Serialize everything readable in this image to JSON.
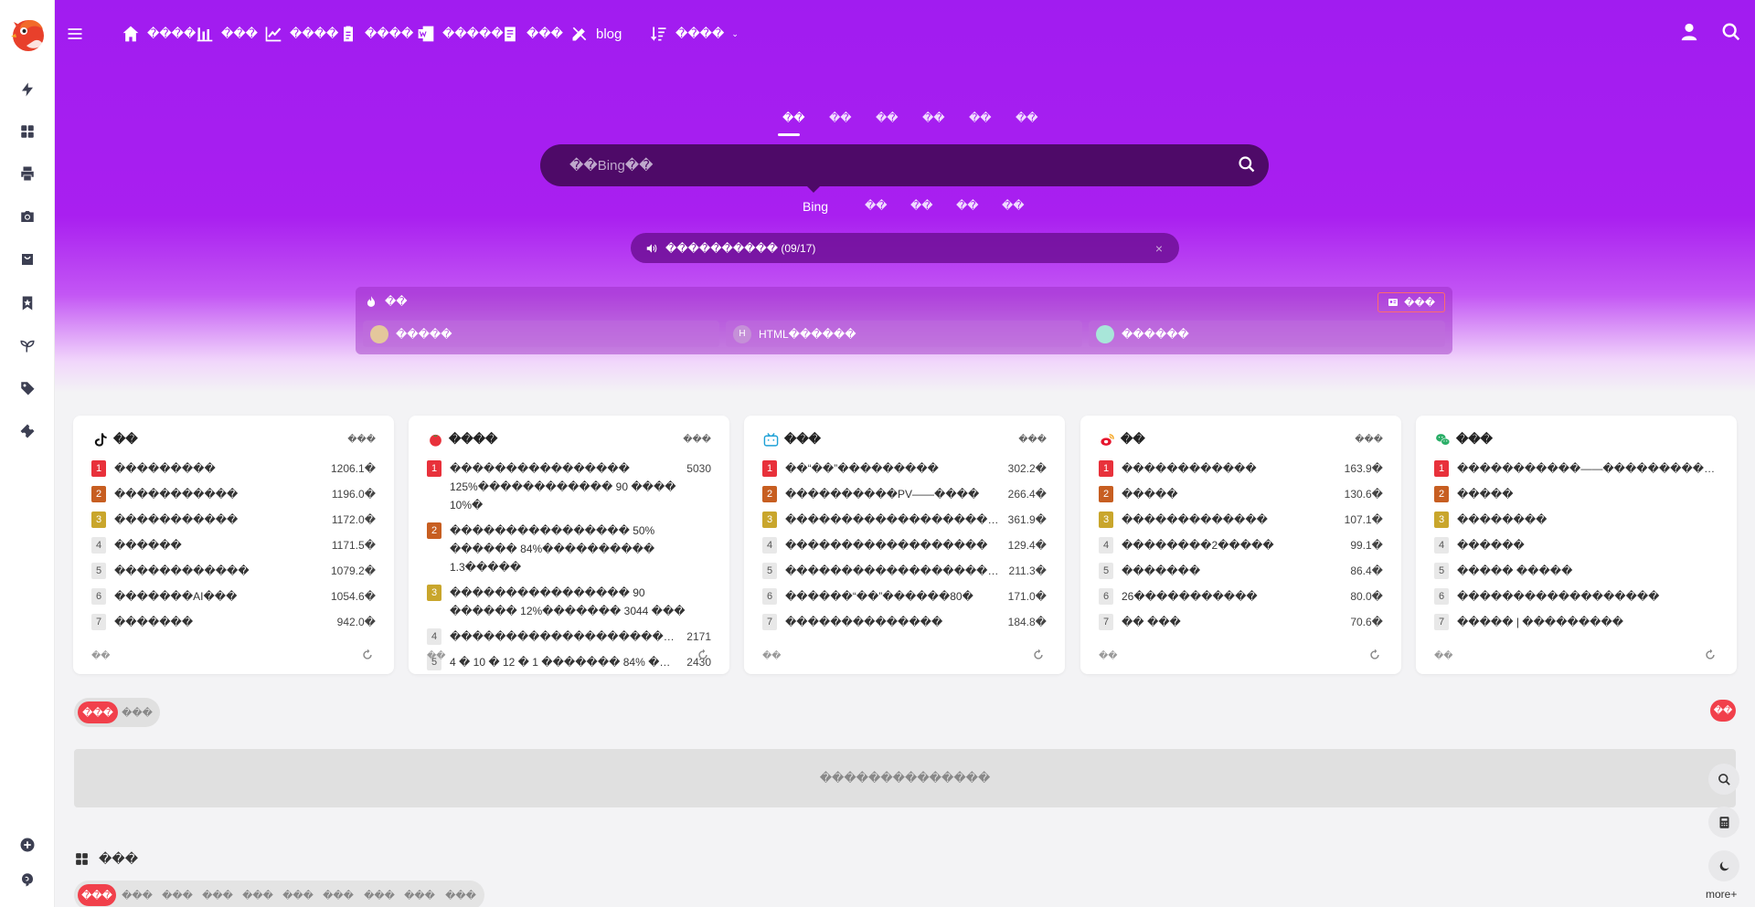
{
  "colors": {
    "accent": "#f1404b",
    "hero": "#a11cf0",
    "search_bg": "#4e0a68"
  },
  "sidebar": {
    "logo": "cardinal-bird-logo",
    "items": [
      {
        "icon": "lightning-icon"
      },
      {
        "icon": "grid-apps-icon"
      },
      {
        "icon": "printer-icon"
      },
      {
        "icon": "camera-icon"
      },
      {
        "icon": "shopping-bag-icon"
      },
      {
        "icon": "bookmark-star-icon"
      },
      {
        "icon": "seedling-icon"
      },
      {
        "icon": "tags-icon"
      },
      {
        "icon": "ticket-icon"
      }
    ],
    "bottom": [
      {
        "icon": "plus-circle-icon"
      },
      {
        "icon": "brain-icon"
      }
    ]
  },
  "nav": {
    "items": [
      {
        "label": "����",
        "icon": "home-icon"
      },
      {
        "label": "���",
        "icon": "bar-chart-icon"
      },
      {
        "label": "����",
        "icon": "line-chart-icon"
      },
      {
        "label": "����",
        "icon": "clipboard-icon"
      },
      {
        "label": "�����",
        "icon": "word-doc-icon"
      },
      {
        "label": "���",
        "icon": "notepad-icon"
      },
      {
        "label": "blog",
        "icon": "pen-ruler-icon"
      },
      {
        "label": "����",
        "icon": "sort-desc-icon"
      }
    ]
  },
  "search": {
    "tabs": [
      "��",
      "��",
      "��",
      "��",
      "��",
      "��"
    ],
    "placeholder": "��Bing��",
    "engines": [
      "Bing",
      "��",
      "��",
      "��",
      "��"
    ]
  },
  "notice": {
    "text": "���������� (09/17)",
    "close": "×"
  },
  "hot": {
    "title": "��",
    "more": "���",
    "links": [
      {
        "label": "�����",
        "avatar": ""
      },
      {
        "label": "HTML������",
        "avatar": "H"
      },
      {
        "label": "������",
        "avatar": ""
      }
    ]
  },
  "cards": [
    {
      "title": "��",
      "icon": "tiktok-icon",
      "more": "���",
      "footer": "��",
      "rows": [
        {
          "rank": "1",
          "text": "���������",
          "value": "1206.1�"
        },
        {
          "rank": "2",
          "text": "�����������",
          "value": "1196.0�"
        },
        {
          "rank": "3",
          "text": "�����������",
          "value": "1172.0�"
        },
        {
          "rank": "4",
          "text": "������",
          "value": "1171.5�"
        },
        {
          "rank": "5",
          "text": "������������",
          "value": "1079.2�"
        },
        {
          "rank": "6",
          "text": "�������AI���",
          "value": "1054.6�"
        },
        {
          "rank": "7",
          "text": "�������",
          "value": "942.0�"
        }
      ]
    },
    {
      "title": "����",
      "icon": "tomato-icon",
      "more": "���",
      "footer": "��",
      "rows": [
        {
          "rank": "1",
          "text": "���������������� 125%������������ 90 ���� 10%�",
          "value": "5030",
          "wrap": true
        },
        {
          "rank": "2",
          "text": "���������������� 50% ������ 84%���������� 1.3�����",
          "value": "",
          "wrap": true
        },
        {
          "rank": "3",
          "text": "���������������� 90 ������ 12%������� 3044 ���",
          "value": "",
          "wrap": true
        },
        {
          "rank": "4",
          "text": "���������������������������������",
          "value": "2171"
        },
        {
          "rank": "5",
          "text": "4 � 10 � 12 � 1 ������� 84% ��������������",
          "value": "2430"
        }
      ]
    },
    {
      "title": "���",
      "icon": "bilibili-tv-icon",
      "more": "���",
      "footer": "��",
      "rows": [
        {
          "rank": "1",
          "text": "��“��”���������",
          "value": "302.2�"
        },
        {
          "rank": "2",
          "text": "����������PV——����",
          "value": "266.4�"
        },
        {
          "rank": "3",
          "text": "������������������50%��",
          "value": "361.9�"
        },
        {
          "rank": "4",
          "text": "������������������",
          "value": "129.4�"
        },
        {
          "rank": "5",
          "text": "����������������������",
          "value": "211.3�"
        },
        {
          "rank": "6",
          "text": "������“��”������80�",
          "value": "171.0�"
        },
        {
          "rank": "7",
          "text": "��������������",
          "value": "184.8�"
        }
      ]
    },
    {
      "title": "��",
      "icon": "weibo-icon",
      "more": "���",
      "footer": "��",
      "rows": [
        {
          "rank": "1",
          "text": "������������",
          "value": "163.9�"
        },
        {
          "rank": "2",
          "text": "�����",
          "value": "130.6�"
        },
        {
          "rank": "3",
          "text": "�������������",
          "value": "107.1�"
        },
        {
          "rank": "4",
          "text": "��������2�����",
          "value": "99.1�"
        },
        {
          "rank": "5",
          "text": "�������",
          "value": "86.4�"
        },
        {
          "rank": "6",
          "text": "26�����������",
          "value": "80.0�"
        },
        {
          "rank": "7",
          "text": "�� ���",
          "value": "70.6�"
        }
      ]
    },
    {
      "title": "���",
      "icon": "wechat-icon",
      "more": "",
      "footer": "��",
      "rows": [
        {
          "rank": "1",
          "text": "�����������——�������������",
          "value": ""
        },
        {
          "rank": "2",
          "text": "�����",
          "value": ""
        },
        {
          "rank": "3",
          "text": "��������",
          "value": ""
        },
        {
          "rank": "4",
          "text": "������",
          "value": ""
        },
        {
          "rank": "5",
          "text": "����� �����",
          "value": ""
        },
        {
          "rank": "6",
          "text": "������������������",
          "value": ""
        },
        {
          "rank": "7",
          "text": "����� | ���������",
          "value": ""
        }
      ]
    }
  ],
  "segment": {
    "on": "���",
    "off": "���"
  },
  "red_pill": "��",
  "empty_text": "��������������",
  "section": {
    "title": "���",
    "icon": "apps-grid-icon"
  },
  "categories": [
    "���",
    "���",
    "���",
    "���",
    "���",
    "���",
    "���",
    "���",
    "���",
    "���"
  ],
  "float_tools": [
    {
      "icon": "search-icon"
    },
    {
      "icon": "calculator-icon"
    },
    {
      "icon": "moon-icon"
    }
  ],
  "more_label": "more+"
}
